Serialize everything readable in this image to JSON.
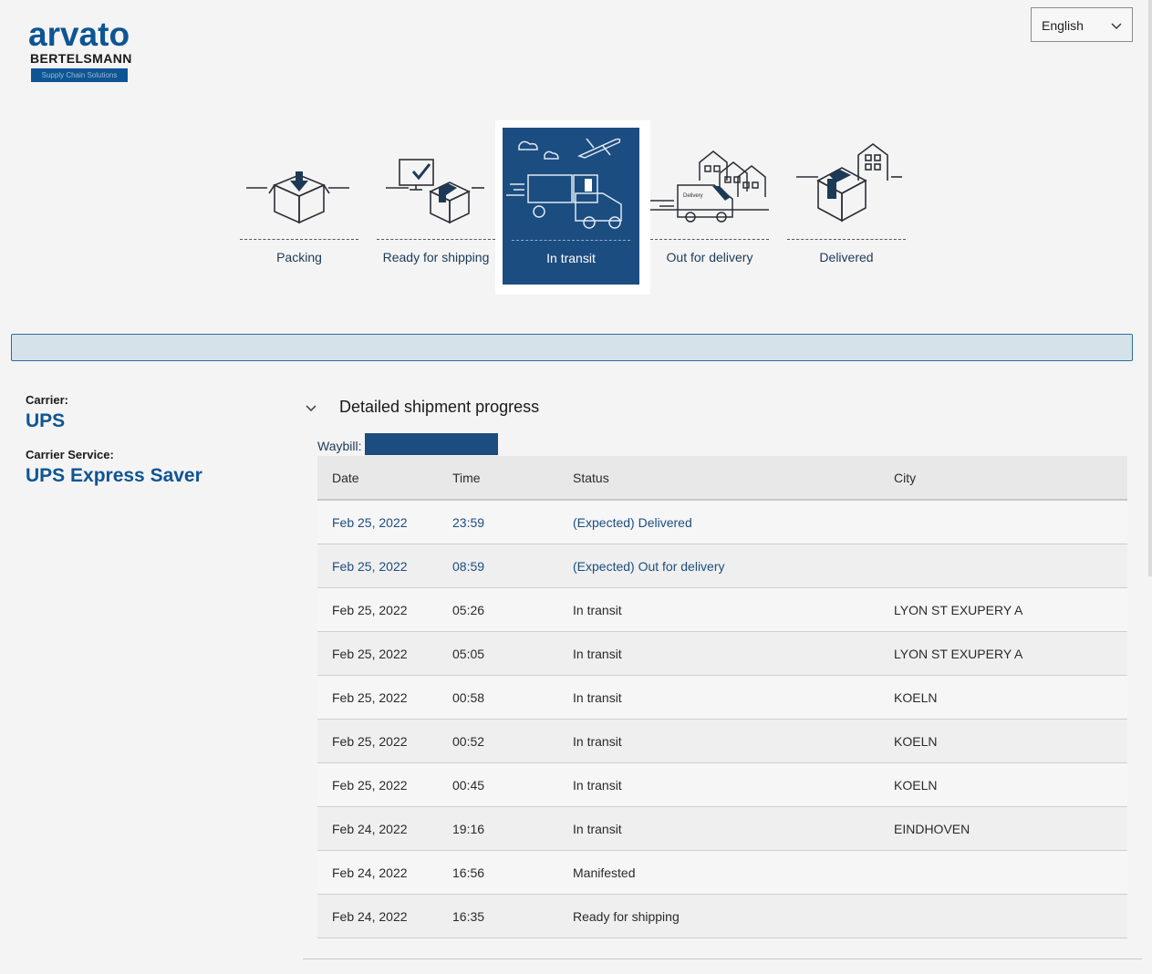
{
  "logo": {
    "word": "arvato",
    "sub": "BERTELSMANN",
    "tagline": "Supply Chain Solutions"
  },
  "language": {
    "selected": "English"
  },
  "steps": [
    {
      "label": "Packing",
      "icon": "open-box-icon",
      "active": false
    },
    {
      "label": "Ready for shipping",
      "icon": "monitor-box-icon",
      "active": false
    },
    {
      "label": "In transit",
      "icon": "truck-plane-icon",
      "active": true
    },
    {
      "label": "Out for delivery",
      "icon": "delivery-van-icon",
      "active": false
    },
    {
      "label": "Delivered",
      "icon": "house-box-icon",
      "active": false
    }
  ],
  "carrier": {
    "label": "Carrier:",
    "value": "UPS",
    "service_label": "Carrier Service:",
    "service_value": "UPS Express Saver"
  },
  "progress": {
    "title": "Detailed shipment progress",
    "waybill_label": "Waybill:",
    "columns": [
      "Date",
      "Time",
      "Status",
      "City"
    ],
    "rows": [
      {
        "date": "Feb 25, 2022",
        "time": "23:59",
        "status": "(Expected) Delivered",
        "city": "",
        "expected": true
      },
      {
        "date": "Feb 25, 2022",
        "time": "08:59",
        "status": "(Expected) Out for delivery",
        "city": "",
        "expected": true
      },
      {
        "date": "Feb 25, 2022",
        "time": "05:26",
        "status": "In transit",
        "city": "LYON ST EXUPERY A",
        "expected": false
      },
      {
        "date": "Feb 25, 2022",
        "time": "05:05",
        "status": "In transit",
        "city": "LYON ST EXUPERY A",
        "expected": false
      },
      {
        "date": "Feb 25, 2022",
        "time": "00:58",
        "status": "In transit",
        "city": "KOELN",
        "expected": false
      },
      {
        "date": "Feb 25, 2022",
        "time": "00:52",
        "status": "In transit",
        "city": "KOELN",
        "expected": false
      },
      {
        "date": "Feb 25, 2022",
        "time": "00:45",
        "status": "In transit",
        "city": "KOELN",
        "expected": false
      },
      {
        "date": "Feb 24, 2022",
        "time": "19:16",
        "status": "In transit",
        "city": "EINDHOVEN",
        "expected": false
      },
      {
        "date": "Feb 24, 2022",
        "time": "16:56",
        "status": "Manifested",
        "city": "",
        "expected": false
      },
      {
        "date": "Feb 24, 2022",
        "time": "16:35",
        "status": "Ready for shipping",
        "city": "",
        "expected": false
      }
    ]
  },
  "colors": {
    "brand": "#0e5593",
    "active_step": "#1c4d80",
    "banner": "#d6e2ea"
  }
}
